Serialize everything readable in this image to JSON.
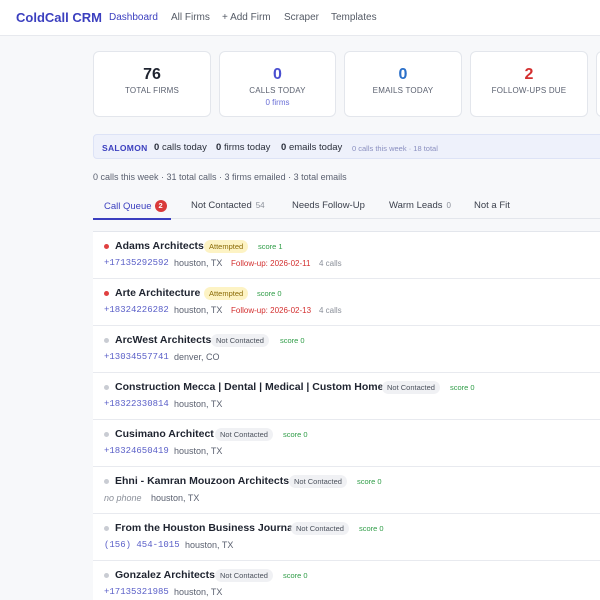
{
  "nav": {
    "brand": "ColdCall CRM",
    "links": [
      "Dashboard",
      "All Firms",
      "+ Add Firm",
      "Scraper",
      "Templates"
    ]
  },
  "stats": [
    {
      "value": "76",
      "label": "TOTAL FIRMS",
      "color": "#1f2430"
    },
    {
      "value": "0",
      "label": "CALLS TODAY",
      "sub": "0 firms",
      "color": "#4a4fd0"
    },
    {
      "value": "0",
      "label": "EMAILS TODAY",
      "color": "#2a6fc9"
    },
    {
      "value": "2",
      "label": "FOLLOW-UPS DUE",
      "color": "#d32f2f"
    }
  ],
  "userbar": {
    "name": "SALOMON",
    "calls_num": "0",
    "calls_text": "calls today",
    "firms_num": "0",
    "firms_text": "firms today",
    "emails_num": "0",
    "emails_text": "emails today",
    "week": "0 calls this week · 18 total"
  },
  "summary": "0 calls this week · 31 total calls · 3 firms emailed · 3 total emails",
  "tabs": [
    {
      "label": "Call Queue",
      "badge": "2"
    },
    {
      "label": "Not Contacted",
      "count": "54"
    },
    {
      "label": "Needs Follow-Up"
    },
    {
      "label": "Warm Leads",
      "count": "0"
    },
    {
      "label": "Not a Fit"
    }
  ],
  "rows": [
    {
      "name": "Adams Architects",
      "status": "Attempted",
      "score": "score 1",
      "phone": "+17135292592",
      "location": "houston, TX",
      "followup": "Follow-up: 2026-02-11",
      "calls": "4 calls"
    },
    {
      "name": "Arte Architecture",
      "status": "Attempted",
      "score": "score 0",
      "phone": "+18324226282",
      "location": "houston, TX",
      "followup": "Follow-up: 2026-02-13",
      "calls": "4 calls"
    },
    {
      "name": "ArcWest Architects",
      "status": "Not Contacted",
      "score": "score 0",
      "phone": "+13034557741",
      "location": "denver, CO"
    },
    {
      "name": "Construction Mecca | Dental | Medical | Custom Home",
      "status": "Not Contacted",
      "score": "score 0",
      "phone": "+18322330814",
      "location": "houston, TX"
    },
    {
      "name": "Cusimano Architect",
      "status": "Not Contacted",
      "score": "score 0",
      "phone": "+18324650419",
      "location": "houston, TX"
    },
    {
      "name": "Ehni - Kamran Mouzoon Architects",
      "status": "Not Contacted",
      "score": "score 0",
      "phone": "no phone",
      "location": "houston, TX"
    },
    {
      "name": "From the Houston Business Journal",
      "status": "Not Contacted",
      "score": "score 0",
      "phone": "(156) 454-1015",
      "location": "houston, TX"
    },
    {
      "name": "Gonzalez Architects",
      "status": "Not Contacted",
      "score": "score 0",
      "phone": "+17135321985",
      "location": "houston, TX"
    }
  ]
}
